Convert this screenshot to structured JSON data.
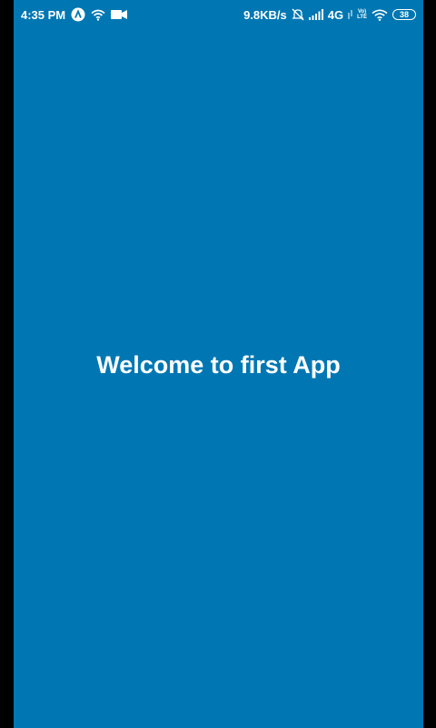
{
  "status_bar": {
    "time": "4:35 PM",
    "network_speed": "9.8KB/s",
    "network_type": "4G",
    "volte_top": "Vo)",
    "volte_bottom": "LTE",
    "battery_level": "38",
    "left_icons": [
      "app-notification-icon",
      "wifi-icon",
      "video-camera-icon"
    ],
    "right_icons": [
      "alarm-off-icon",
      "signal-bars-icon",
      "volte-icon",
      "wifi-icon",
      "battery-icon"
    ]
  },
  "main": {
    "welcome_text": "Welcome to first App"
  },
  "colors": {
    "background": "#0077b3",
    "text": "#ffffff",
    "frame": "#000000"
  }
}
